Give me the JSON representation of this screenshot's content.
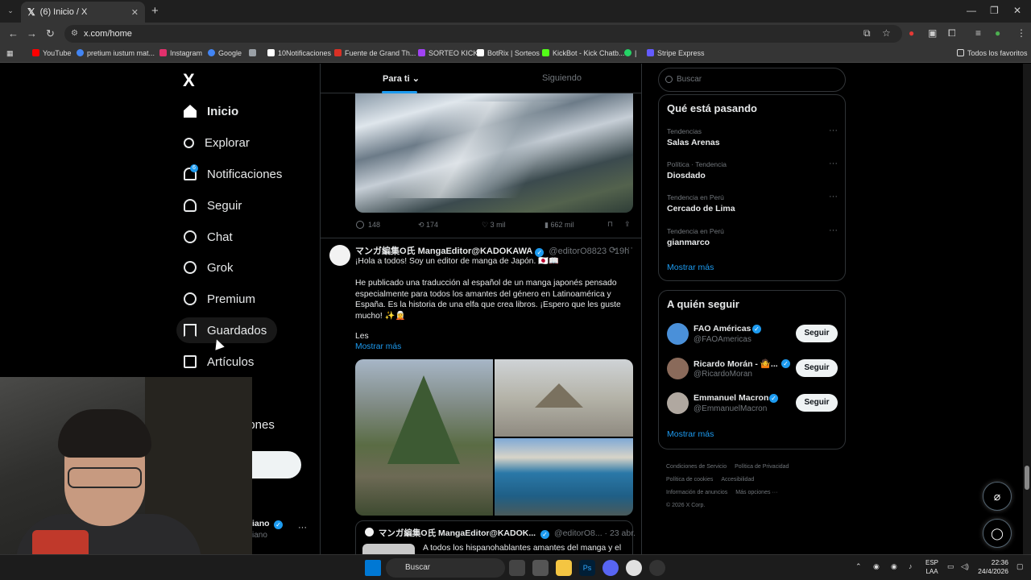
{
  "browser": {
    "tab_title": "(6) Inicio / X",
    "url": "x.com/home",
    "bookmarks": [
      {
        "label": "YouTube",
        "color": "#ff0000"
      },
      {
        "label": "pretium iustum mat...",
        "color": "#4285f4"
      },
      {
        "label": "Instagram",
        "color": "#e1306c"
      },
      {
        "label": "Google",
        "color": "#4285f4"
      },
      {
        "label": "",
        "color": "#9aa0a6"
      },
      {
        "label": "10Notificaciones",
        "color": "#ffffff"
      },
      {
        "label": "Fuente de Grand Th...",
        "color": "#d93025"
      },
      {
        "label": "SORTEO KICK",
        "color": "#a142f4"
      },
      {
        "label": "BotRix | Sorteos",
        "color": "#ffffff"
      },
      {
        "label": "KickBot - Kick Chatb...",
        "color": "#53fc18"
      },
      {
        "label": "|",
        "color": "#25d366"
      },
      {
        "label": "Stripe Express",
        "color": "#635bff"
      }
    ],
    "all_bookmarks": "Todos los favoritos"
  },
  "sidebar": {
    "logo": "X",
    "notif_count": "6",
    "items": [
      {
        "label": "Inicio",
        "icon": "home-icon"
      },
      {
        "label": "Explorar",
        "icon": "search-icon"
      },
      {
        "label": "Notificaciones",
        "icon": "bell-icon"
      },
      {
        "label": "Seguir",
        "icon": "person-add-icon"
      },
      {
        "label": "Chat",
        "icon": "chat-icon"
      },
      {
        "label": "Grok",
        "icon": "grok-icon"
      },
      {
        "label": "Premium",
        "icon": "premium-icon"
      },
      {
        "label": "Guardados",
        "icon": "bookmark-icon"
      },
      {
        "label": "Artículos",
        "icon": "articles-icon"
      }
    ],
    "partial_config": "iones",
    "partial_post": "r",
    "partial_profile_name": "iano",
    "partial_profile_handle": "iano",
    "more": "···"
  },
  "timeline": {
    "tab_for_you": "Para ti",
    "tab_following": "Siguiendo",
    "post1_actions": {
      "replies": "148",
      "reposts": "174",
      "likes": "3 mil",
      "views": "662 mil"
    },
    "post2": {
      "name": "マンガ編集O氏 MangaEditor@KADOKAWA",
      "handle": "@editorO8823 · 19h",
      "line1": "¡Hola a todos! Soy un editor de manga de Japón. 🇯🇵📖",
      "body": "He publicado una traducción al español de un manga japonés pensado especialmente para todos los amantes del género en Latinoamérica y España. Es la historia de una elfa que crea libros. ¡Espero que les guste mucho! ✨🧝",
      "les": "Les",
      "show_more": "Mostrar más"
    },
    "quote": {
      "name": "マンガ編集O氏 MangaEditor@KADOK...",
      "handle": "@editorO8...",
      "date": "· 23 abr.",
      "text": "A todos los hispanohablantes amantes del manga y el"
    }
  },
  "right": {
    "search_placeholder": "Buscar",
    "trends_title": "Qué está pasando",
    "trends": [
      {
        "meta": "Tendencias",
        "name": "Salas Arenas"
      },
      {
        "meta": "Política · Tendencia",
        "name": "Diosdado"
      },
      {
        "meta": "Tendencia en Perú",
        "name": "Cercado de Lima"
      },
      {
        "meta": "Tendencia en Perú",
        "name": "gianmarco"
      }
    ],
    "trends_more": "Mostrar más",
    "follow_title": "A quién seguir",
    "follow": [
      {
        "name": "FAO Américas",
        "handle": "@FAOAmericas",
        "color": "#4a90d9"
      },
      {
        "name": "Ricardo Morán - 🤷...",
        "handle": "@RicardoMoran",
        "color": "#8a6a5a"
      },
      {
        "name": "Emmanuel Macron",
        "handle": "@EmmanuelMacron",
        "color": "#b0a8a0"
      }
    ],
    "follow_btn": "Seguir",
    "follow_more": "Mostrar más",
    "footer": [
      "Condiciones de Servicio",
      "Política de Privacidad",
      "Política de cookies",
      "Accesibilidad",
      "Información de anuncios",
      "Más opciones ···",
      "© 2026 X Corp."
    ]
  },
  "taskbar": {
    "search": "Buscar",
    "lang1": "ESP",
    "lang2": "LAA",
    "time": "22:36",
    "date": "24/4/2026"
  }
}
